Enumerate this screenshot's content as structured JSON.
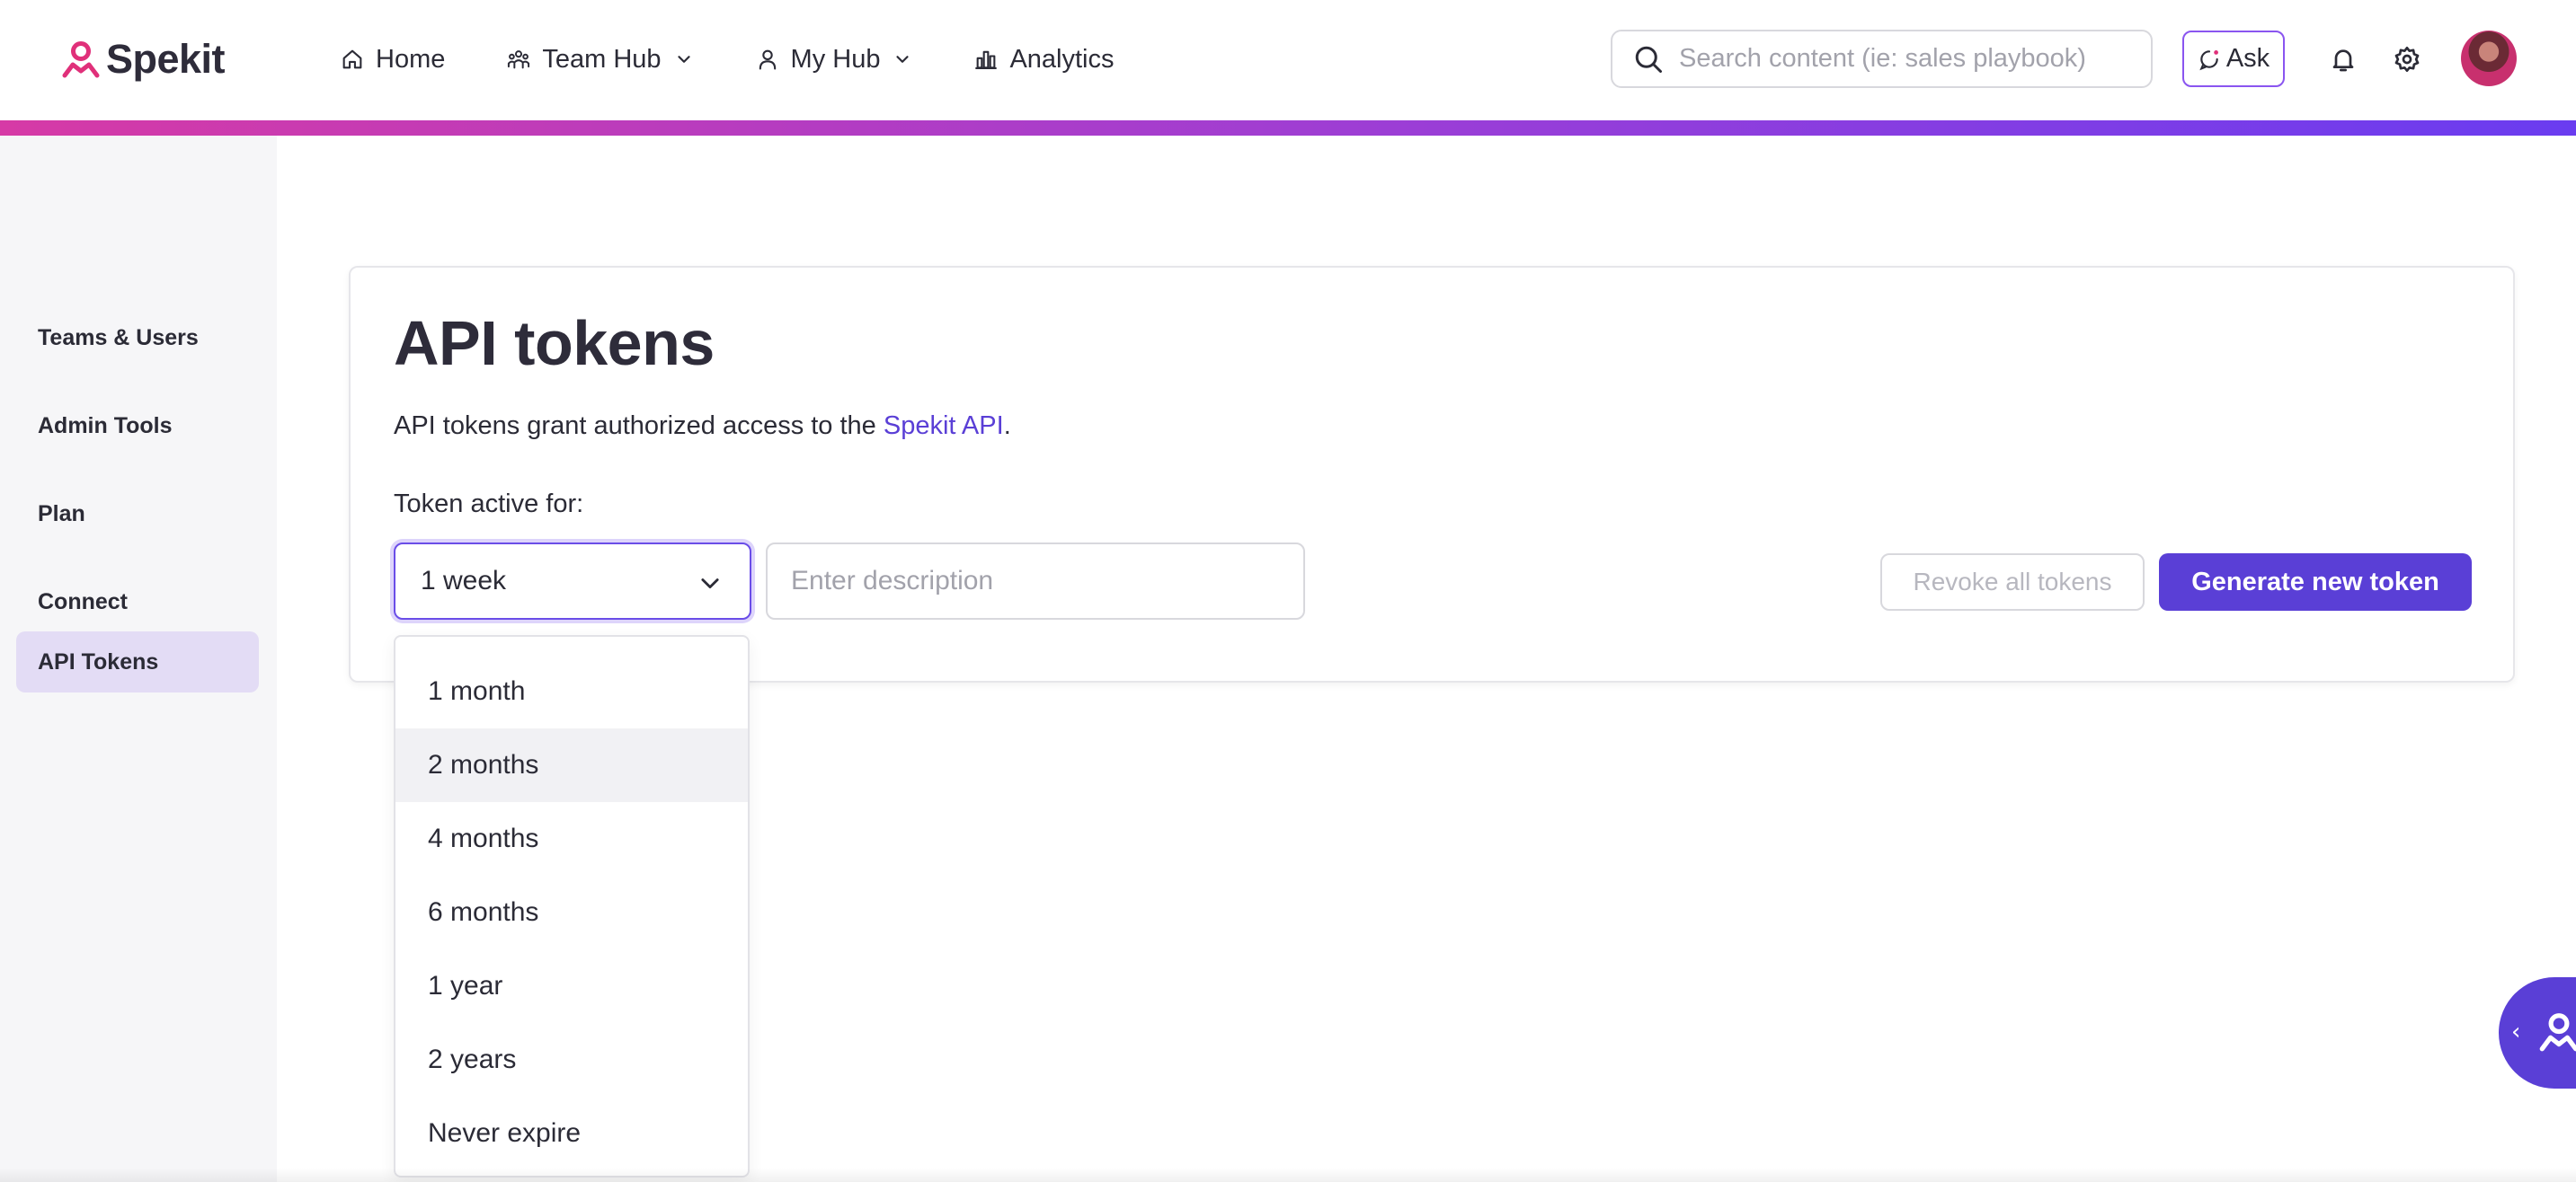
{
  "app": {
    "logo_text": "Spekit",
    "brand_color": "#5a3fd6",
    "accent_pink": "#e0307a"
  },
  "nav": {
    "home": "Home",
    "team_hub": "Team Hub",
    "my_hub": "My Hub",
    "analytics": "Analytics"
  },
  "search": {
    "placeholder": "Search content (ie: sales playbook)",
    "value": ""
  },
  "ask": {
    "label": "Ask"
  },
  "sidebar": {
    "items": [
      {
        "label": "Teams & Users",
        "active": false
      },
      {
        "label": "Admin Tools",
        "active": false
      },
      {
        "label": "Plan",
        "active": false
      },
      {
        "label": "Connect",
        "active": false
      },
      {
        "label": "API Tokens",
        "active": true
      }
    ]
  },
  "main": {
    "title": "API tokens",
    "subtitle_prefix": "API tokens grant authorized access to the ",
    "subtitle_link": "Spekit API",
    "subtitle_suffix": ".",
    "field_label": "Token active for:",
    "selected_duration": "1 week",
    "description_placeholder": "Enter description",
    "description_value": "",
    "revoke_label": "Revoke all tokens",
    "generate_label": "Generate new token"
  },
  "dropdown": {
    "options": [
      "1 month",
      "2 months",
      "4 months",
      "6 months",
      "1 year",
      "2 years",
      "Never expire"
    ],
    "highlighted": "2 months"
  },
  "icons": {
    "home": "home-icon",
    "team_hub": "team-icon",
    "my_hub": "user-icon",
    "analytics": "bar-chart-icon",
    "search": "search-icon",
    "ask": "sparkle-chat-icon",
    "notifications": "bell-icon",
    "settings": "gear-icon",
    "select": "chevron-down-icon",
    "helper": "spekit-helper-icon"
  }
}
